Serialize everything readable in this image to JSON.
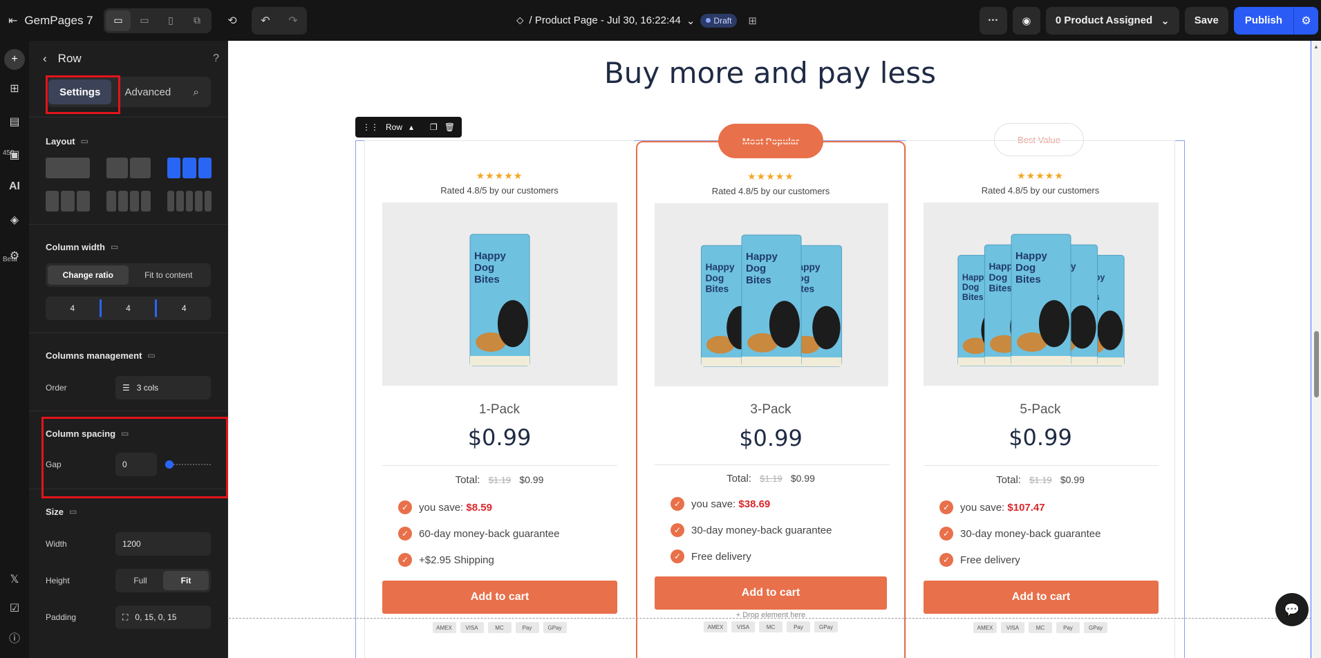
{
  "topbar": {
    "app_name": "GemPages 7",
    "page_title": "/ Product Page - Jul 30, 16:22:44",
    "draft_label": "Draft",
    "product_assigned": "0 Product Assigned",
    "save_label": "Save",
    "publish_label": "Publish"
  },
  "rail": {
    "badge_count": "450",
    "ai_label": "AI",
    "beta_label": "Beta"
  },
  "panel": {
    "title": "Row",
    "tabs": {
      "settings": "Settings",
      "advanced": "Advanced"
    },
    "layout": {
      "title": "Layout"
    },
    "column_width": {
      "title": "Column width",
      "change_ratio": "Change ratio",
      "fit_to_content": "Fit to content",
      "ratios": [
        "4",
        "4",
        "4"
      ]
    },
    "columns_management": {
      "title": "Columns management",
      "order_label": "Order",
      "order_value": "3 cols"
    },
    "column_spacing": {
      "title": "Column spacing",
      "gap_label": "Gap",
      "gap_value": "0",
      "gap_slider_fraction": 0
    },
    "size": {
      "title": "Size",
      "width_label": "Width",
      "width_value": "1200",
      "height_label": "Height",
      "height_full": "Full",
      "height_fit": "Fit",
      "padding_label": "Padding",
      "padding_value": "0, 15, 0, 15"
    }
  },
  "canvas": {
    "headline": "Buy more and pay less",
    "row_toolbar_label": "Row",
    "drop_hint": "Drop element here",
    "cards": [
      {
        "badge": "",
        "stars": "★★★★★",
        "rated": "Rated 4.8/5 by our customers",
        "pack": "1-Pack",
        "price": "$0.99",
        "total_label": "Total:",
        "total_old": "$1.19",
        "total_new": "$0.99",
        "save_label": "you save:",
        "save_amount": "$8.59",
        "feature_2": "60-day money-back guarantee",
        "feature_3": "+$2.95 Shipping",
        "cart": "Add to cart",
        "bags": 1
      },
      {
        "badge": "Most Popular",
        "stars": "★★★★★",
        "rated": "Rated 4.8/5 by our customers",
        "pack": "3-Pack",
        "price": "$0.99",
        "total_label": "Total:",
        "total_old": "$1.19",
        "total_new": "$0.99",
        "save_label": "you save:",
        "save_amount": "$38.69",
        "feature_2": "30-day money-back guarantee",
        "feature_3": "Free delivery",
        "cart": "Add to cart",
        "bags": 3
      },
      {
        "badge": "Best Value",
        "stars": "★★★★★",
        "rated": "Rated 4.8/5 by our customers",
        "pack": "5-Pack",
        "price": "$0.99",
        "total_label": "Total:",
        "total_old": "$1.19",
        "total_new": "$0.99",
        "save_label": "you save:",
        "save_amount": "$107.47",
        "feature_2": "30-day money-back guarantee",
        "feature_3": "Free delivery",
        "cart": "Add to cart",
        "bags": 5
      }
    ],
    "product_bag_text": "Happy Dog Bites",
    "payment_icons": [
      "AMEX",
      "VISA",
      "MC",
      "Pay",
      "GPay"
    ]
  },
  "colors": {
    "accent": "#e8704a",
    "publish": "#2a5bf5",
    "highlight_red": "#e3141b",
    "panel_bg": "#1e1e1e",
    "selection_blue": "#2a66f6"
  }
}
